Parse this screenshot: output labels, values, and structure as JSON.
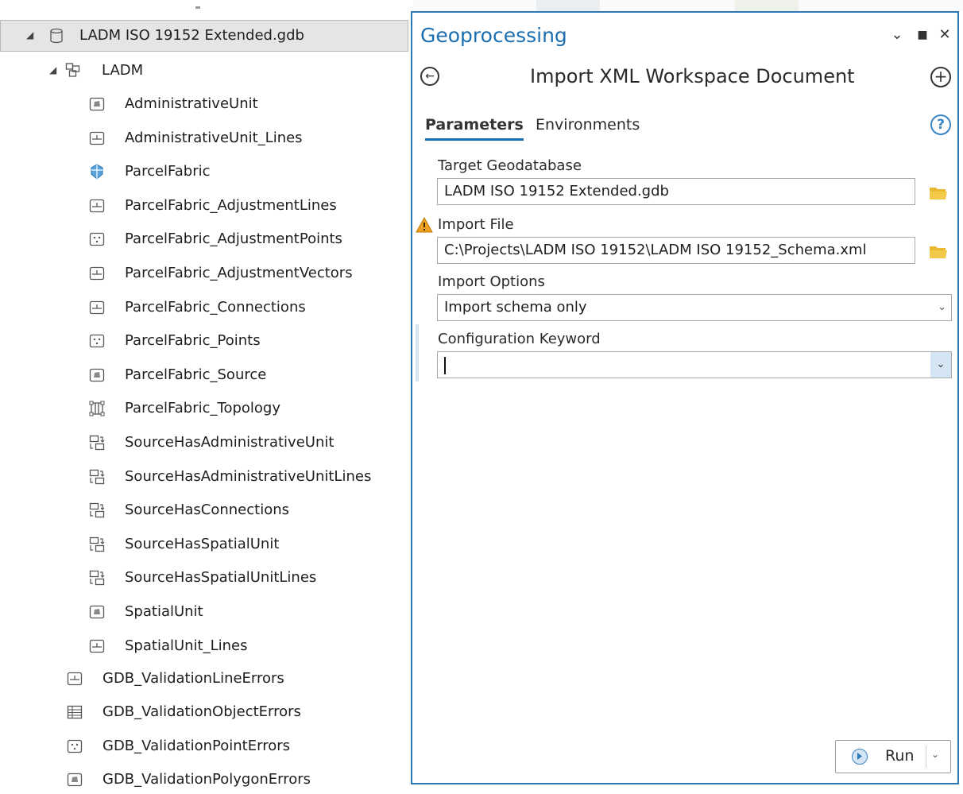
{
  "tree": {
    "root": {
      "label": "LADM ISO 19152 Extended.gdb"
    },
    "dataset": {
      "label": "LADM"
    },
    "items": [
      {
        "label": "AdministrativeUnit",
        "icon": "polygon-feature-class-icon"
      },
      {
        "label": "AdministrativeUnit_Lines",
        "icon": "line-feature-class-icon"
      },
      {
        "label": "ParcelFabric",
        "icon": "parcel-fabric-icon"
      },
      {
        "label": "ParcelFabric_AdjustmentLines",
        "icon": "line-feature-class-icon"
      },
      {
        "label": "ParcelFabric_AdjustmentPoints",
        "icon": "point-feature-class-icon"
      },
      {
        "label": "ParcelFabric_AdjustmentVectors",
        "icon": "line-feature-class-icon"
      },
      {
        "label": "ParcelFabric_Connections",
        "icon": "line-feature-class-icon"
      },
      {
        "label": "ParcelFabric_Points",
        "icon": "point-feature-class-icon"
      },
      {
        "label": "ParcelFabric_Source",
        "icon": "polygon-feature-class-icon"
      },
      {
        "label": "ParcelFabric_Topology",
        "icon": "topology-icon"
      },
      {
        "label": "SourceHasAdministrativeUnit",
        "icon": "relationship-class-icon"
      },
      {
        "label": "SourceHasAdministrativeUnitLines",
        "icon": "relationship-class-icon"
      },
      {
        "label": "SourceHasConnections",
        "icon": "relationship-class-icon"
      },
      {
        "label": "SourceHasSpatialUnit",
        "icon": "relationship-class-icon"
      },
      {
        "label": "SourceHasSpatialUnitLines",
        "icon": "relationship-class-icon"
      },
      {
        "label": "SpatialUnit",
        "icon": "polygon-feature-class-icon"
      },
      {
        "label": "SpatialUnit_Lines",
        "icon": "line-feature-class-icon"
      }
    ],
    "root_items": [
      {
        "label": "GDB_ValidationLineErrors",
        "icon": "line-feature-class-icon"
      },
      {
        "label": "GDB_ValidationObjectErrors",
        "icon": "table-icon"
      },
      {
        "label": "GDB_ValidationPointErrors",
        "icon": "point-feature-class-icon"
      },
      {
        "label": "GDB_ValidationPolygonErrors",
        "icon": "polygon-feature-class-icon"
      }
    ]
  },
  "pane": {
    "title": "Geoprocessing",
    "controls": {
      "menu": "⌄",
      "maximize": "■",
      "close": "✕"
    },
    "tool_title": "Import XML Workspace Document",
    "back_glyph": "←",
    "add_glyph": "+",
    "help_glyph": "?",
    "tabs": {
      "parameters": "Parameters",
      "environments": "Environments"
    },
    "params": {
      "target_gdb_label": "Target Geodatabase",
      "target_gdb_value": "LADM ISO 19152 Extended.gdb",
      "import_file_label": "Import File",
      "import_file_value": "C:\\Projects\\LADM ISO 19152\\LADM ISO 19152_Schema.xml",
      "import_options_label": "Import Options",
      "import_options_value": "Import schema only",
      "config_keyword_label": "Configuration Keyword",
      "config_keyword_value": ""
    },
    "run_label": "Run",
    "colors": {
      "accent": "#1b6fb0",
      "warning": "#f0a020",
      "folder": "#e8b830"
    }
  }
}
